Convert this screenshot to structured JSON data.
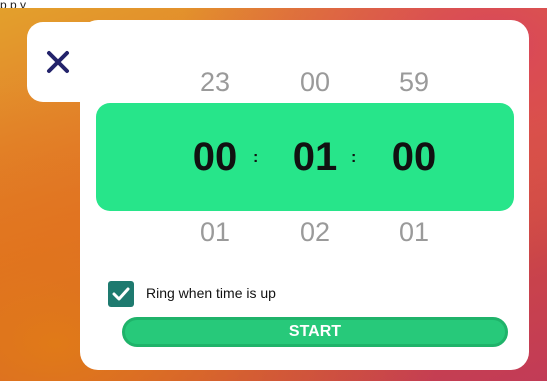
{
  "header_fragment": "p                  p            y",
  "timer": {
    "prev": {
      "hours": "23",
      "minutes": "00",
      "seconds": "59"
    },
    "current": {
      "hours": "00",
      "minutes": "01",
      "seconds": "00"
    },
    "next": {
      "hours": "01",
      "minutes": "02",
      "seconds": "01"
    },
    "separator": ":"
  },
  "ring_option": {
    "label": "Ring when time is up",
    "checked": true
  },
  "start_button": {
    "label": "START"
  },
  "colors": {
    "accent": "#27e58a",
    "checkbox": "#1e7a6f",
    "close": "#23236b",
    "start": "#27c97a"
  }
}
